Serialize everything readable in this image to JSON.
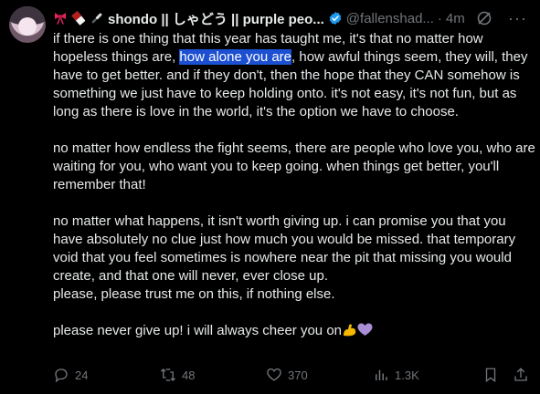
{
  "header": {
    "display_name": "shondo || しゃどう || purple peo...",
    "handle": "@fallenshad...",
    "separator": "·",
    "time": "4m",
    "more": "···"
  },
  "tweet": {
    "p1_before": "if there is one thing that this year has taught me, it's that no matter how hopeless things are, ",
    "p1_highlight": "how alone you are",
    "p1_after": ", how awful things seem, they will, they have to get better. and if they don't, then the hope that they CAN somehow is something we just have to keep holding onto. it's not easy, it's not fun, but as long as there is love in the world, it's the option we have to choose.",
    "p2": "no matter how endless the fight seems, there are people who love you, who are waiting for you, who want you to keep going. when things get better, you'll remember that!",
    "p3": "no matter what happens, it isn't worth giving up. i can promise you that you have absolutely no clue just how much you would be missed. that temporary void that you feel sometimes is nowhere near the pit that missing you would create, and that one will never, ever close up.",
    "p3b": "please, please trust me on this, if nothing else.",
    "p4": "please never give up! i will always cheer you on"
  },
  "actions": {
    "replies": "24",
    "reposts": "48",
    "likes": "370",
    "views": "1.3K"
  },
  "icons": {
    "header_emojis": [
      "ribbon-icon",
      "chocolate-icon",
      "knife-icon"
    ],
    "verified": "verified-badge-icon",
    "grok": "grok-icon",
    "more": "more-icon",
    "end_emojis": [
      "flexed-biceps-icon",
      "purple-heart-icon"
    ],
    "action_icons": [
      "reply-icon",
      "repost-icon",
      "like-icon",
      "views-icon",
      "bookmark-icon",
      "share-icon"
    ]
  },
  "colors": {
    "background": "#000000",
    "text": "#e7e9ea",
    "muted": "#71767b",
    "highlight": "#1c4fd1",
    "verified": "#1d9bf0"
  }
}
